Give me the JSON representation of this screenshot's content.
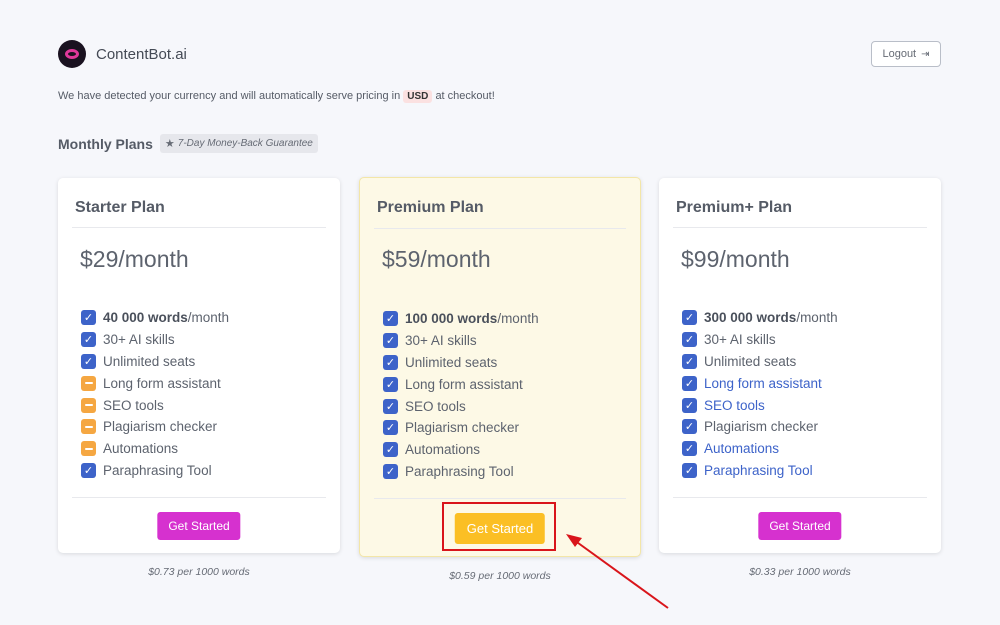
{
  "brand": {
    "name": "ContentBot.ai"
  },
  "header": {
    "logout_label": "Logout",
    "logout_icon": "sign-out-icon"
  },
  "notice": {
    "prefix": "We have detected your currency and will automatically serve pricing in",
    "currency": "USD",
    "suffix": "at checkout!"
  },
  "plans_section": {
    "title": "Monthly Plans",
    "guarantee": "7-Day Money-Back Guarantee"
  },
  "plans": [
    {
      "title": "Starter Plan",
      "price": "$29/month",
      "button": "Get Started",
      "per_words": "$0.73 per 1000 words",
      "features": [
        {
          "bold": "40 000 words",
          "label": "/month",
          "state": "check"
        },
        {
          "bold": "",
          "label": "30+ AI skills",
          "state": "check"
        },
        {
          "bold": "",
          "label": "Unlimited seats",
          "state": "check"
        },
        {
          "bold": "",
          "label": "Long form assistant",
          "state": "minus"
        },
        {
          "bold": "",
          "label": "SEO tools",
          "state": "minus"
        },
        {
          "bold": "",
          "label": "Plagiarism checker",
          "state": "minus"
        },
        {
          "bold": "",
          "label": "Automations",
          "state": "minus"
        },
        {
          "bold": "",
          "label": "Paraphrasing Tool",
          "state": "check"
        }
      ]
    },
    {
      "title": "Premium Plan",
      "price": "$59/month",
      "button": "Get Started",
      "per_words": "$0.59 per 1000 words",
      "features": [
        {
          "bold": "100 000 words",
          "label": "/month",
          "state": "check"
        },
        {
          "bold": "",
          "label": "30+ AI skills",
          "state": "check"
        },
        {
          "bold": "",
          "label": "Unlimited seats",
          "state": "check"
        },
        {
          "bold": "",
          "label": "Long form assistant",
          "state": "check"
        },
        {
          "bold": "",
          "label": "SEO tools",
          "state": "check"
        },
        {
          "bold": "",
          "label": "Plagiarism checker",
          "state": "check"
        },
        {
          "bold": "",
          "label": "Automations",
          "state": "check"
        },
        {
          "bold": "",
          "label": "Paraphrasing Tool",
          "state": "check"
        }
      ]
    },
    {
      "title": "Premium+ Plan",
      "price": "$99/month",
      "button": "Get Started",
      "per_words": "$0.33 per 1000 words",
      "features": [
        {
          "bold": "300 000 words",
          "label": "/month",
          "state": "check"
        },
        {
          "bold": "",
          "label": "30+ AI skills",
          "state": "check"
        },
        {
          "bold": "",
          "label": "Unlimited seats",
          "state": "check"
        },
        {
          "bold": "",
          "label": "Long form assistant",
          "state": "check",
          "highlight": true
        },
        {
          "bold": "",
          "label": "SEO tools",
          "state": "check",
          "highlight": true
        },
        {
          "bold": "",
          "label": "Plagiarism checker",
          "state": "check"
        },
        {
          "bold": "",
          "label": "Automations",
          "state": "check",
          "highlight": true
        },
        {
          "bold": "",
          "label": "Paraphrasing Tool",
          "state": "check",
          "highlight": true
        }
      ]
    }
  ],
  "colors": {
    "accent_blue": "#3d63c9",
    "minus_orange": "#f5a742",
    "button_magenta": "#d631cf",
    "button_yellow": "#fbbf24",
    "annotation_red": "#d9151b"
  }
}
